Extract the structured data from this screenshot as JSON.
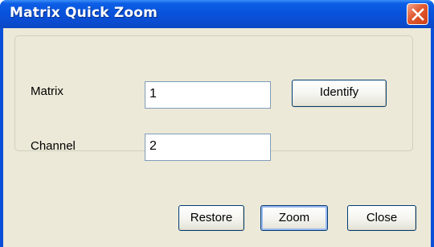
{
  "window": {
    "title": "Matrix Quick Zoom"
  },
  "form": {
    "matrix_label": "Matrix",
    "matrix_value": "1",
    "channel_label": "Channel",
    "channel_value": "2"
  },
  "buttons": {
    "identify": "Identify",
    "restore": "Restore",
    "zoom": "Zoom",
    "close": "Close"
  },
  "icons": {
    "close": "close-icon"
  },
  "colors": {
    "titlebar": "#0853dc",
    "dialog_bg": "#ece9d8",
    "close_button": "#e2592f"
  }
}
